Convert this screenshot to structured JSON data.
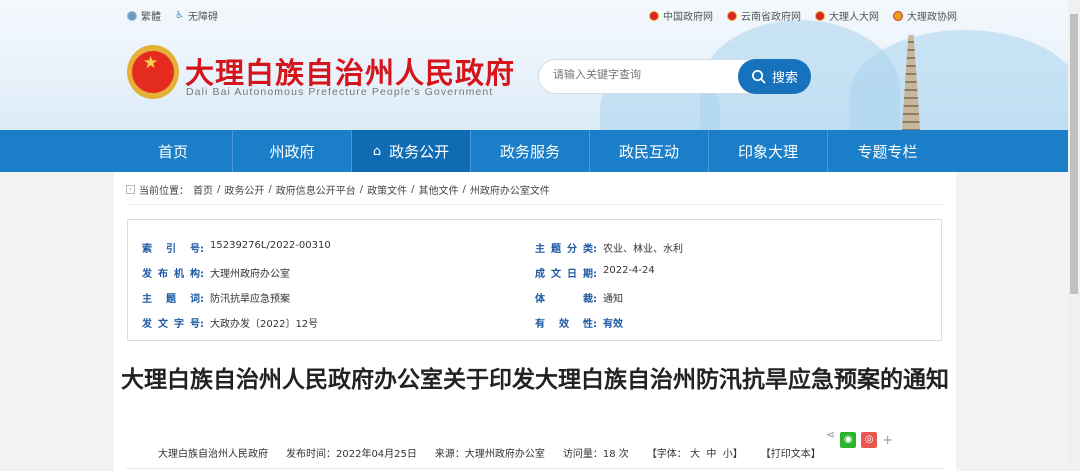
{
  "header": {
    "tools": [
      "繁體",
      "无障碍"
    ],
    "links": [
      "中国政府网",
      "云南省政府网",
      "大理人大网",
      "大理政协网"
    ],
    "title": "大理白族自治州人民政府",
    "subtitle": "Dali Bai Autonomous Prefecture People's Government",
    "search_placeholder": "请输入关键字查询",
    "search_button": "搜索"
  },
  "nav": [
    "首页",
    "州政府",
    "政务公开",
    "政务服务",
    "政民互动",
    "印象大理",
    "专题专栏"
  ],
  "breadcrumb": {
    "label": "当前位置：",
    "items": [
      "首页",
      "政务公开",
      "政府信息公开平台",
      "政策文件",
      "其他文件",
      "州政府办公室文件"
    ]
  },
  "info": {
    "left": [
      {
        "label": [
          "索",
          "引",
          "号:"
        ],
        "value": "15239276L/2022-00310"
      },
      {
        "label": [
          "发",
          "布",
          "机",
          "构:"
        ],
        "value": "大理州政府办公室"
      },
      {
        "label": [
          "主",
          "题",
          "词:"
        ],
        "value": "防汛抗旱应急预案"
      },
      {
        "label": [
          "发",
          "文",
          "字",
          "号:"
        ],
        "value": "大政办发〔2022〕12号"
      }
    ],
    "right": [
      {
        "label": [
          "主",
          "题",
          "分",
          "类:"
        ],
        "value": "农业、林业、水利"
      },
      {
        "label": [
          "成",
          "文",
          "日",
          "期:"
        ],
        "value": "2022-4-24"
      },
      {
        "label": [
          "体",
          "裁:"
        ],
        "value": "通知"
      },
      {
        "label": [
          "有",
          "效",
          "性:"
        ],
        "value": "有效"
      }
    ]
  },
  "article": {
    "title": "大理白族自治州人民政府办公室关于印发大理白族自治州防汛抗旱应急预案的通知",
    "publisher": "大理白族自治州人民政府",
    "date": "发布时间：2022年04月25日",
    "source": "来源：大理州政府办公室",
    "visits": "访问量：18 次",
    "font_label": "【字体：",
    "font_sizes": [
      "大",
      "中",
      "小"
    ],
    "font_end": "】",
    "print": "【打印文本】"
  },
  "colors": {
    "nav": "#1a7ec8",
    "title": "#d6141b",
    "label": "#1d5aa3"
  }
}
